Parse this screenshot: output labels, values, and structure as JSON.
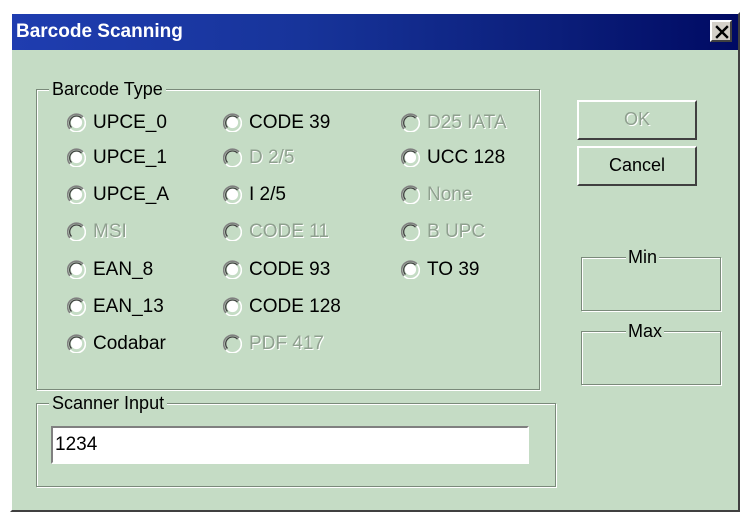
{
  "window": {
    "title": "Barcode Scanning",
    "close_label": "Close"
  },
  "barcode_group": {
    "label": "Barcode Type",
    "options": [
      {
        "label": "UPCE_0",
        "enabled": true
      },
      {
        "label": "CODE 39",
        "enabled": true
      },
      {
        "label": "D25 IATA",
        "enabled": false
      },
      {
        "label": "UPCE_1",
        "enabled": true
      },
      {
        "label": "D 2/5",
        "enabled": false
      },
      {
        "label": "UCC 128",
        "enabled": true
      },
      {
        "label": "UPCE_A",
        "enabled": true
      },
      {
        "label": "I 2/5",
        "enabled": true
      },
      {
        "label": "None",
        "enabled": false
      },
      {
        "label": "MSI",
        "enabled": false
      },
      {
        "label": "CODE 11",
        "enabled": false
      },
      {
        "label": "B UPC",
        "enabled": false
      },
      {
        "label": "EAN_8",
        "enabled": true
      },
      {
        "label": "CODE 93",
        "enabled": true
      },
      {
        "label": "TO 39",
        "enabled": true
      },
      {
        "label": "EAN_13",
        "enabled": true
      },
      {
        "label": "CODE 128",
        "enabled": true
      },
      {
        "label": "Codabar",
        "enabled": true
      },
      {
        "label": "PDF 417",
        "enabled": false
      }
    ]
  },
  "buttons": {
    "ok_label": "OK",
    "ok_enabled": false,
    "cancel_label": "Cancel"
  },
  "min_group": {
    "label": "Min"
  },
  "max_group": {
    "label": "Max"
  },
  "scanner_group": {
    "label": "Scanner Input",
    "value": "1234"
  },
  "colors": {
    "dialog_bg": "#c5dcc5",
    "titlebar_start": "#1f3db0",
    "titlebar_end": "#000a63",
    "disabled_text": "#8fa08f"
  }
}
